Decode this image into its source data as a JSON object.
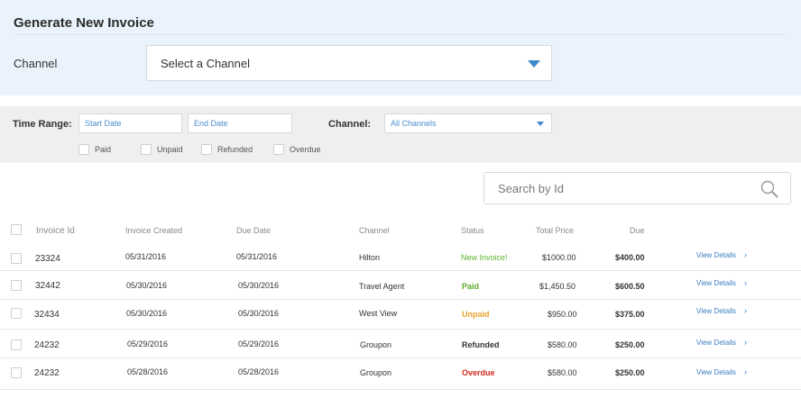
{
  "generate": {
    "title": "Generate New Invoice",
    "channel_label": "Channel",
    "channel_select_value": "Select a Channel"
  },
  "filters": {
    "time_range_label": "Time Range:",
    "start_date_placeholder": "Start Date",
    "end_date_placeholder": "End Date",
    "channel_label": "Channel:",
    "channel_value": "All Channels",
    "status_options": [
      "Paid",
      "Unpaid",
      "Refunded",
      "Overdue"
    ]
  },
  "search": {
    "placeholder": "Search by Id"
  },
  "table": {
    "headers": [
      "Invoice Id",
      "Invoice Created",
      "Due Date",
      "Channel",
      "Status",
      "Total Price",
      "Due"
    ],
    "rows": [
      {
        "id": "23324",
        "created": "05/31/2016",
        "due_date": "05/31/2016",
        "channel": "Hilton",
        "status": "New Invoice!",
        "total": "$1000.00",
        "due": "$400.00",
        "action": "View Details"
      },
      {
        "id": "32442",
        "created": "05/30/2016",
        "due_date": "05/30/2016",
        "channel": "Travel Agent",
        "status": "Paid",
        "total": "$1,450.50",
        "due": "$600.50",
        "action": "View Details"
      },
      {
        "id": "32434",
        "created": "05/30/2016",
        "due_date": "05/30/2016",
        "channel": "West View",
        "status": "Unpaid",
        "total": "$950.00",
        "due": "$375.00",
        "action": "View Details"
      },
      {
        "id": "24232",
        "created": "05/29/2016",
        "due_date": "05/29/2016",
        "channel": "Groupon",
        "status": "Refunded",
        "total": "$580.00",
        "due": "$250.00",
        "action": "View Details"
      },
      {
        "id": "24232",
        "created": "05/28/2016",
        "due_date": "05/28/2016",
        "channel": "Groupon",
        "status": "Overdue",
        "total": "$580.00",
        "due": "$250.00",
        "action": "View Details"
      }
    ]
  },
  "colors": {
    "accent": "#3b87c9",
    "status_new": "#59b42f",
    "status_paid": "#5fae2e",
    "status_unpaid": "#e8a32a",
    "status_overdue": "#d0281c"
  }
}
